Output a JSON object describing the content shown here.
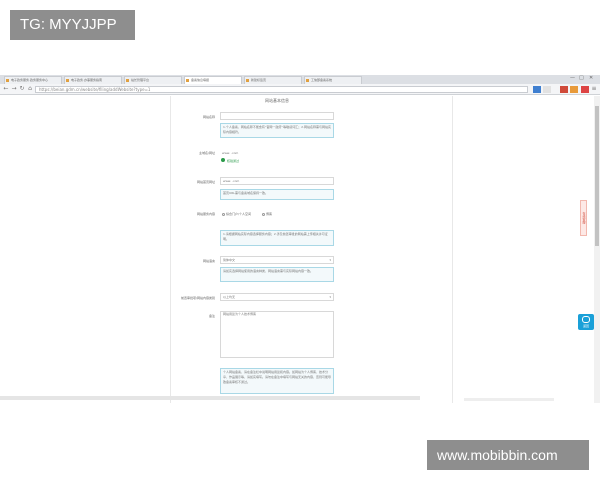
{
  "watermarks": {
    "top_left": "TG: MYYJJPP",
    "bottom_right": "www.mobibbin.com"
  },
  "browser": {
    "tabs": [
      {
        "label": "电子政务服务·政务服务中心"
      },
      {
        "label": "电子政务·办事服务指南"
      },
      {
        "label": "站长管理平台"
      },
      {
        "label": "备案信息填报",
        "active": true
      },
      {
        "label": "新建标签页"
      },
      {
        "label": "工信部备案系统"
      }
    ],
    "window_controls": [
      "—",
      "□",
      "✕"
    ],
    "url": "https://beian.gdm.cn/website/filing/addWebsite?type=1"
  },
  "form": {
    "title": "网站基本信息",
    "fields": {
      "site_name": {
        "label": "网站名称",
        "value": ""
      },
      "site_name_hint": "1.个人备案，网站名称不能含有“官网”“政府”等敏感词汇；2.网站名称需与网站实际内容相符。",
      "domain": {
        "label": "主域名/网址",
        "value": "www.           .com"
      },
      "domain_status": "核验通过",
      "homepage": {
        "label": "网站首页网址",
        "value": "www.           .com"
      },
      "homepage_hint": "首页URL需与备案域名保持一致。",
      "service_type": {
        "label": "网站服务内容",
        "options": [
          "综合门户/个人空间",
          "博客"
        ]
      },
      "service_hint": "1.请根据网站实际内容选择服务内容；2.涉及前置审批的网站需上传相关许可证明。",
      "language": {
        "label": "网站语言",
        "value": "简体中文"
      },
      "language_hint": "请如实选择网站使用的语言种类，网站语言需与实际网站内容一致。",
      "pre_approval": {
        "label": "前置审批项/网站内容类别",
        "value": "以上均无"
      },
      "remark": {
        "label": "备注",
        "value": "网站用途为个人技术博客"
      },
      "remark_hint": "个人网站备案，请在备注栏中说明网站用途和内容。如网站为个人博客、技术分享、作品展示等，请如实填写。请勿在备注中填写与网站无关的内容，否则可能导致备案审核不通过。"
    }
  },
  "page_extras": {
    "side_tab": "在线客服",
    "float_button": "返回"
  }
}
